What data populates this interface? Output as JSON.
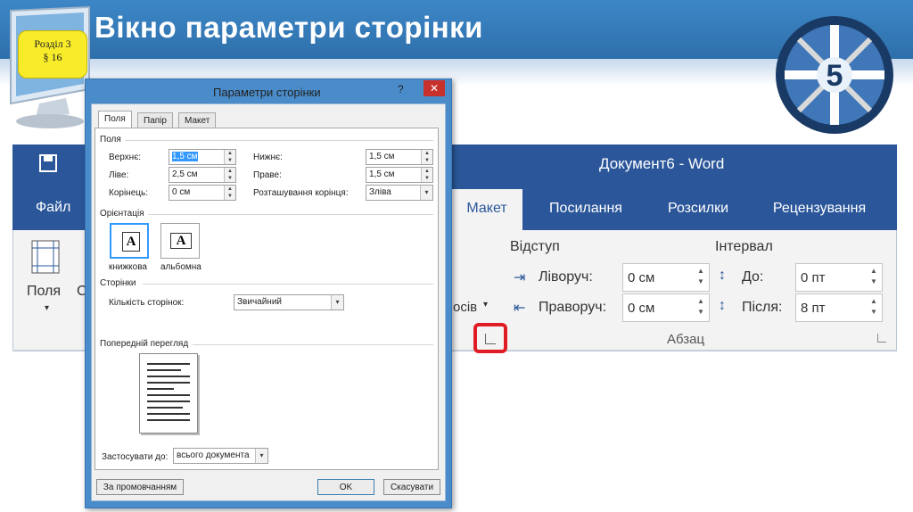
{
  "slide": {
    "title": "Вікно параметри сторінки",
    "badge_line1": "Розділ 3",
    "badge_line2": "§ 16",
    "logo_number": "5"
  },
  "word": {
    "window_title": "Документ6 - Word",
    "tabs": [
      "Файл",
      "Макет",
      "Посилання",
      "Розсилки",
      "Рецензування"
    ],
    "fields_label": "Поля",
    "partial_label": "С",
    "intervals_fragment": "осів",
    "indent_header": "Відступ",
    "spacing_header": "Інтервал",
    "left_label": "Ліворуч:",
    "left_value": "0 см",
    "right_label": "Праворуч:",
    "right_value": "0 см",
    "before_label": "До:",
    "before_value": "0 пт",
    "after_label": "Після:",
    "after_value": "8 пт",
    "paragraph_group": "Абзац",
    "accent": "#2b579a",
    "highlight": "#e01c24"
  },
  "dialog": {
    "title": "Параметри сторінки",
    "help": "?",
    "tabs": [
      "Поля",
      "Папір",
      "Макет"
    ],
    "margins_section": "Поля",
    "top_label": "Верхнє:",
    "top_value": "1,5 см",
    "bottom_label": "Нижнє:",
    "bottom_value": "1,5 см",
    "left_label": "Ліве:",
    "left_value": "2,5 см",
    "right_label": "Праве:",
    "right_value": "1,5 см",
    "gutter_label": "Корінець:",
    "gutter_value": "0 см",
    "gutter_pos_label": "Розташування корінця:",
    "gutter_pos_value": "Зліва",
    "orientation_section": "Орієнтація",
    "portrait_label": "книжкова",
    "landscape_label": "альбомна",
    "orient_glyph": "A",
    "pages_section": "Сторінки",
    "pages_label": "Кількість сторінок:",
    "pages_value": "Звичайний",
    "preview_section": "Попередній перегляд",
    "apply_label": "Застосувати до:",
    "apply_value": "всього документа",
    "default_button": "За промовчанням",
    "ok_button": "OK",
    "cancel_button": "Скасувати"
  }
}
